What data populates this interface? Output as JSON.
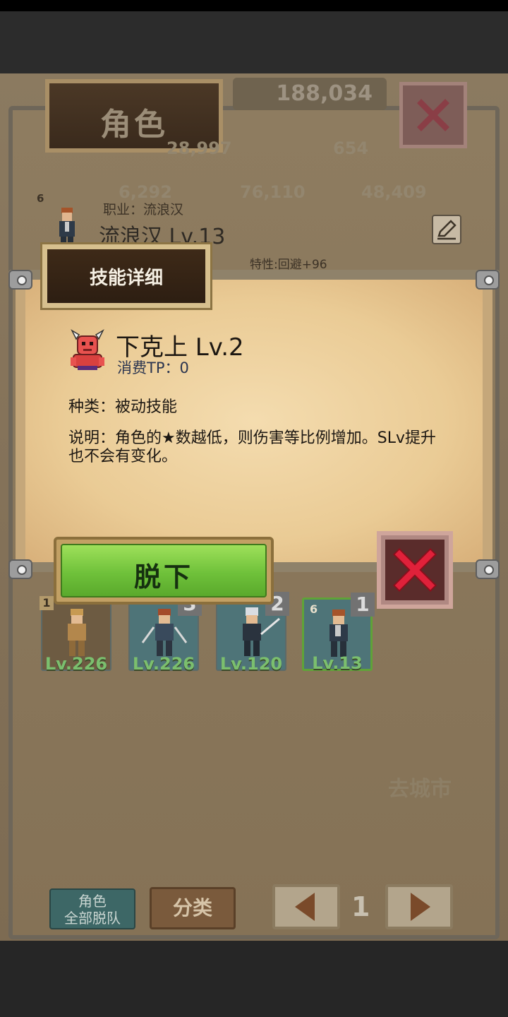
{
  "screen": {
    "title": "角色",
    "money": "188,034",
    "stats": [
      "28,997",
      "654",
      "6,292",
      "76,110",
      "48,409"
    ],
    "character": {
      "star": "6",
      "job_label": "职业：流浪汉",
      "name": "流浪汉 Lv.13",
      "trait": "特性:回避+96"
    },
    "cards": [
      {
        "num": "1",
        "level": "Lv.226"
      },
      {
        "num": "3",
        "level": "Lv.226"
      },
      {
        "num": "2",
        "level": "Lv.120"
      },
      {
        "num": "1",
        "star": "6",
        "level": "Lv.13"
      }
    ],
    "go_city": "去城市",
    "buttons": {
      "leave_all": "角色\n全部脱队",
      "sort": "分类",
      "page": "1"
    }
  },
  "modal": {
    "tab_title": "技能详细",
    "skill_name": "下克上 Lv.2",
    "tp_cost": "消费TP：0",
    "type": "种类：被动技能",
    "description": "说明：角色的★数越低，则伤害等比例增加。SLv提升也不会有变化。",
    "unequip_label": "脱下"
  },
  "colors": {
    "close": "#e0213a",
    "unequip_green": "#7ccd45"
  },
  "icons": [
    "close-icon",
    "edit-icon",
    "arrow-left-icon",
    "arrow-right-icon",
    "skill-demon-icon"
  ]
}
